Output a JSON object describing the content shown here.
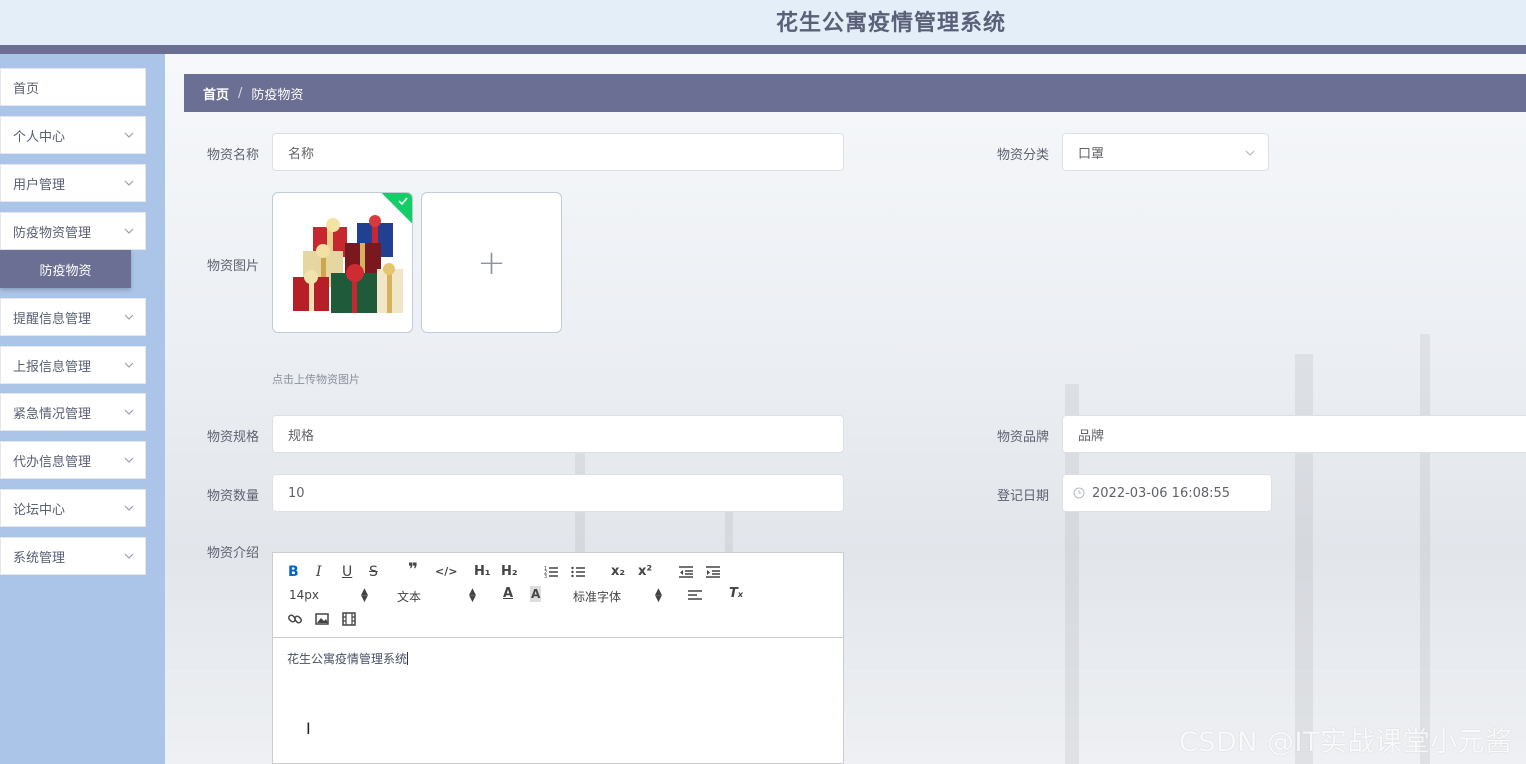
{
  "app": {
    "title": "花生公寓疫情管理系统"
  },
  "sidebar": {
    "items": [
      {
        "label": "首页"
      },
      {
        "label": "个人中心"
      },
      {
        "label": "用户管理"
      },
      {
        "label": "防疫物资管理"
      },
      {
        "label": "提醒信息管理"
      },
      {
        "label": "上报信息管理"
      },
      {
        "label": "紧急情况管理"
      },
      {
        "label": "代办信息管理"
      },
      {
        "label": "论坛中心"
      },
      {
        "label": "系统管理"
      }
    ],
    "active_sub": "防疫物资"
  },
  "breadcrumb": {
    "home": "首页",
    "separator": "/",
    "current": "防疫物资"
  },
  "form": {
    "name": {
      "label": "物资名称",
      "placeholder": "名称"
    },
    "category": {
      "label": "物资分类",
      "value": "口罩"
    },
    "image": {
      "label": "物资图片",
      "tip": "点击上传物资图片",
      "plus": "+"
    },
    "spec": {
      "label": "物资规格",
      "placeholder": "规格"
    },
    "brand": {
      "label": "物资品牌",
      "placeholder": "品牌"
    },
    "quantity": {
      "label": "物资数量",
      "value": "10"
    },
    "date": {
      "label": "登记日期",
      "value": "2022-03-06 16:08:55"
    },
    "intro": {
      "label": "物资介绍"
    }
  },
  "editor": {
    "font_size": "14px",
    "header_picker": "文本",
    "font_family": "标准字体",
    "content": "花生公寓疫情管理系统"
  },
  "watermark": "CSDN @IT实战课堂小元酱",
  "colors": {
    "accent": "#6b6f93",
    "sidebar_bg": "#aac5e8",
    "header_bg": "#e3eef9",
    "success": "#13ce66"
  }
}
